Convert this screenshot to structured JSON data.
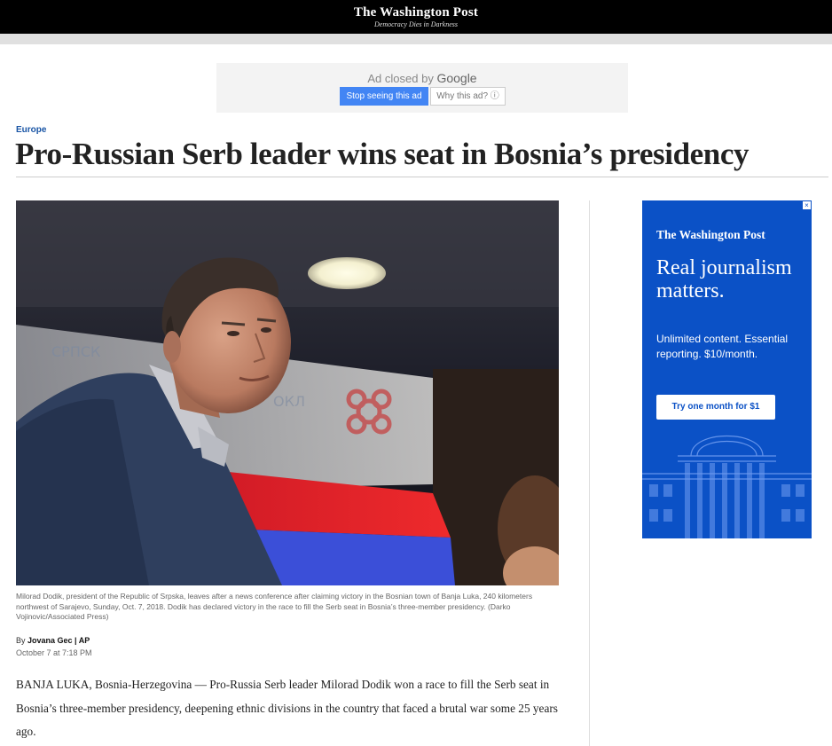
{
  "header": {
    "masthead": "The Washington Post",
    "tagline": "Democracy Dies in Darkness"
  },
  "top_ad": {
    "closed_text": "Ad closed by",
    "google_text": "Google",
    "stop_button": "Stop seeing this ad",
    "why_button": "Why this ad?",
    "why_icon": "info-icon"
  },
  "article": {
    "section": "Europe",
    "headline": "Pro-Russian Serb leader wins seat in Bosnia’s presidency",
    "caption": "Milorad Dodik, president of the Republic of Srpska, leaves after a news conference after claiming victory in the Bosnian town of Banja Luka, 240 kilometers northwest of Sarajevo, Sunday, Oct. 7, 2018. Dodik has declared victory in the race to fill the Serb seat in Bosnia’s three-member presidency. (Darko Vojinovic/Associated Press)",
    "byline_prefix": "By",
    "author": "Jovana Gec | AP",
    "date": "October 7 at 7:18 PM",
    "body": "BANJA LUKA, Bosnia-Herzegovina — Pro-Russia Serb leader Milorad Dodik won a race to fill the Serb seat in Bosnia’s three-member presidency, deepening ethnic divisions in the country that faced a brutal war some 25 years ago."
  },
  "side_ad": {
    "logo": "The Washington Post",
    "title": "Real journalism matters.",
    "subtitle": "Unlimited content. Essential reporting. $10/month.",
    "cta": "Try one month for $1",
    "close_label": "×"
  },
  "colors": {
    "kicker": "#1955a5",
    "ad_blue": "#0b51c6",
    "google_blue": "#4285f4"
  }
}
